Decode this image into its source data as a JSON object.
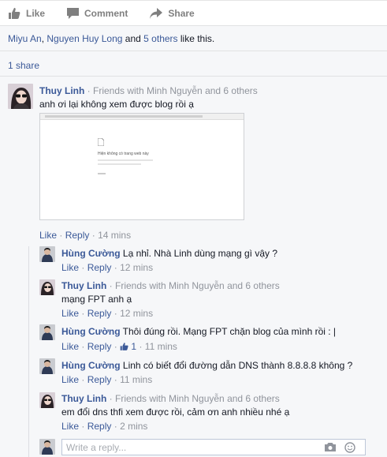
{
  "actions": {
    "like": "Like",
    "comment": "Comment",
    "share": "Share"
  },
  "likes": {
    "user1": "Miyu An",
    "comma": ",",
    "user2": "Nguyen Huy Long",
    "and": "and",
    "others": "5 others",
    "suffix": "like this."
  },
  "shares": "1 share",
  "comment": {
    "author": "Thuy Linh",
    "meta": "· Friends with Minh Nguyễn and 6 others",
    "text": "anh ơi lại không xem được blog rồi ạ",
    "attachment_text": "Hiện không có trang web này",
    "like": "Like",
    "reply": "Reply",
    "time": "14 mins"
  },
  "replies": [
    {
      "author": "Hùng Cường",
      "meta": "",
      "text": "Lạ nhỉ. Nhà Linh dùng mạng gì vậy ?",
      "time": "12 mins",
      "likes": ""
    },
    {
      "author": "Thuy Linh",
      "meta": "· Friends with Minh Nguyễn and 6 others",
      "text": "mạng FPT anh ạ",
      "time": "12 mins",
      "likes": ""
    },
    {
      "author": "Hùng Cường",
      "meta": "",
      "text": "Thôi đúng rồi. Mạng FPT chặn blog của mình rồi : |",
      "time": "11 mins",
      "likes": "1"
    },
    {
      "author": "Hùng Cường",
      "meta": "",
      "text": "Linh có biết đổi đường dẫn DNS thành 8.8.8.8 không ?",
      "time": "11 mins",
      "likes": ""
    },
    {
      "author": "Thuy Linh",
      "meta": "· Friends with Minh Nguyễn and 6 others",
      "text": "em đổi dns thfi xem được rồi, cảm ơn anh nhiều nhé ạ",
      "time": "2 mins",
      "likes": ""
    }
  ],
  "reply_labels": {
    "like": "Like",
    "reply": "Reply",
    "dot": "·"
  },
  "reply_box": {
    "placeholder": "Write a reply..."
  },
  "colors": {
    "link": "#3b5998",
    "meta": "#90949c",
    "background": "#f6f7f9"
  }
}
